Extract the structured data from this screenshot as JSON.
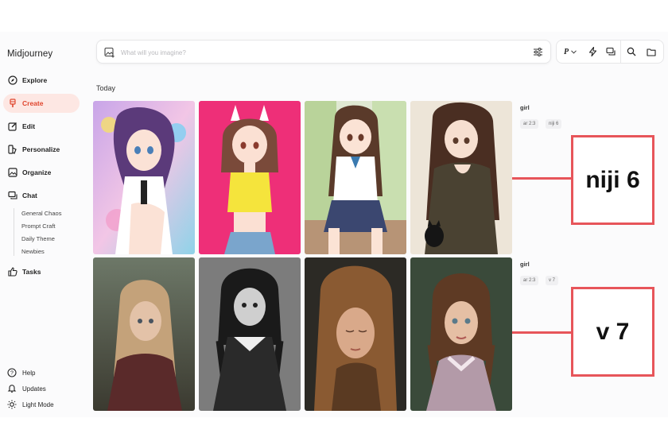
{
  "app": {
    "name": "Midjourney"
  },
  "sidebar": {
    "items": [
      {
        "label": "Explore",
        "icon": "compass-icon"
      },
      {
        "label": "Create",
        "icon": "brush-icon",
        "active": true
      },
      {
        "label": "Edit",
        "icon": "edit-icon"
      },
      {
        "label": "Personalize",
        "icon": "palette-icon"
      },
      {
        "label": "Organize",
        "icon": "image-icon"
      },
      {
        "label": "Chat",
        "icon": "chat-icon"
      }
    ],
    "chat_rooms": [
      "General Chaos",
      "Prompt Craft",
      "Daily Theme",
      "Newbies"
    ],
    "tasks": {
      "label": "Tasks",
      "icon": "thumbs-up-icon"
    },
    "bottom": [
      {
        "label": "Help",
        "icon": "help-icon"
      },
      {
        "label": "Updates",
        "icon": "bell-icon"
      },
      {
        "label": "Light Mode",
        "icon": "sun-icon"
      }
    ]
  },
  "search": {
    "placeholder": "What will you imagine?",
    "value": ""
  },
  "toolbar": {
    "personalize_label": "P"
  },
  "feed": {
    "section_title": "Today",
    "groups": [
      {
        "prompt": "girl",
        "tags": [
          "ar 2:3",
          "niji 6"
        ],
        "annotation": "niji 6"
      },
      {
        "prompt": "girl",
        "tags": [
          "ar 2:3",
          "v 7"
        ],
        "annotation": "v 7"
      }
    ]
  },
  "colors": {
    "accent": "#e0452d",
    "active_bg": "#fde7e3",
    "callout_border": "#e7555a"
  }
}
